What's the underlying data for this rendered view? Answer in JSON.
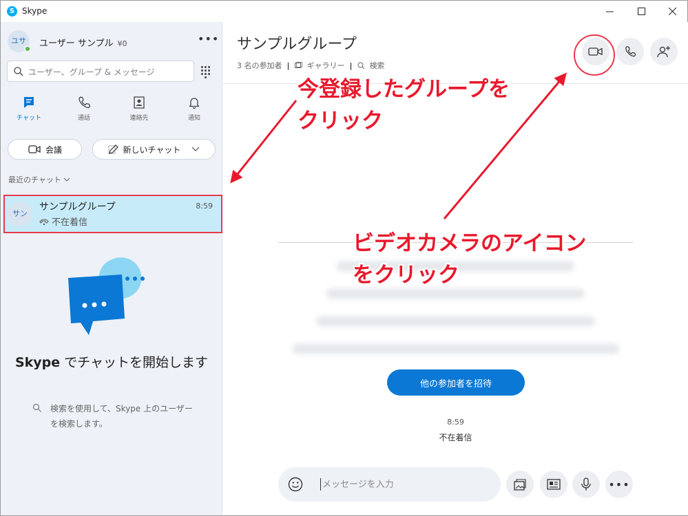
{
  "window": {
    "title": "Skype",
    "app_icon_letter": "S",
    "minimize": "—",
    "maximize": "☐",
    "close": "✕"
  },
  "profile": {
    "initials": "ユサ",
    "name": "ユーザー サンプル",
    "credit": "¥0",
    "more": "•••"
  },
  "search": {
    "placeholder": "ユーザー、グループ & メッセージ"
  },
  "nav": {
    "tabs": [
      {
        "label": "チャット",
        "icon": "chat-icon",
        "active": true
      },
      {
        "label": "通話",
        "icon": "phone-icon",
        "active": false
      },
      {
        "label": "連絡先",
        "icon": "contacts-icon",
        "active": false
      },
      {
        "label": "通知",
        "icon": "bell-icon",
        "active": false
      }
    ]
  },
  "actions": {
    "meet_label": "会議",
    "new_chat_label": "新しいチャット"
  },
  "recent": {
    "label": "最近のチャット",
    "items": [
      {
        "initials": "サン",
        "name": "サンプルグループ",
        "subtitle": "不在着信",
        "time": "8:59"
      }
    ]
  },
  "empty_state": {
    "title_brand": "Skype",
    "title_rest": " でチャットを開始します",
    "description": "検索を使用して、Skype 上のユーザーを検索します。"
  },
  "conversation": {
    "title": "サンプルグループ",
    "participants": "3 名の参加者",
    "gallery": "ギャラリー",
    "search": "検索",
    "invite_button": "他の参加者を招待",
    "system_time": "8:59",
    "system_text": "不在着信",
    "composer_placeholder": "メッセージを入力",
    "more": "•••"
  },
  "annotations": {
    "group_line1": "今登録したグループを",
    "group_line2": "クリック",
    "video_line1": "ビデオカメラのアイコン",
    "video_line2": "をクリック"
  },
  "colors": {
    "accent": "#0a78d4",
    "annotation_red": "#e8192c",
    "selection": "#c7ebf8",
    "sidebar_bg": "#eef1f7"
  }
}
